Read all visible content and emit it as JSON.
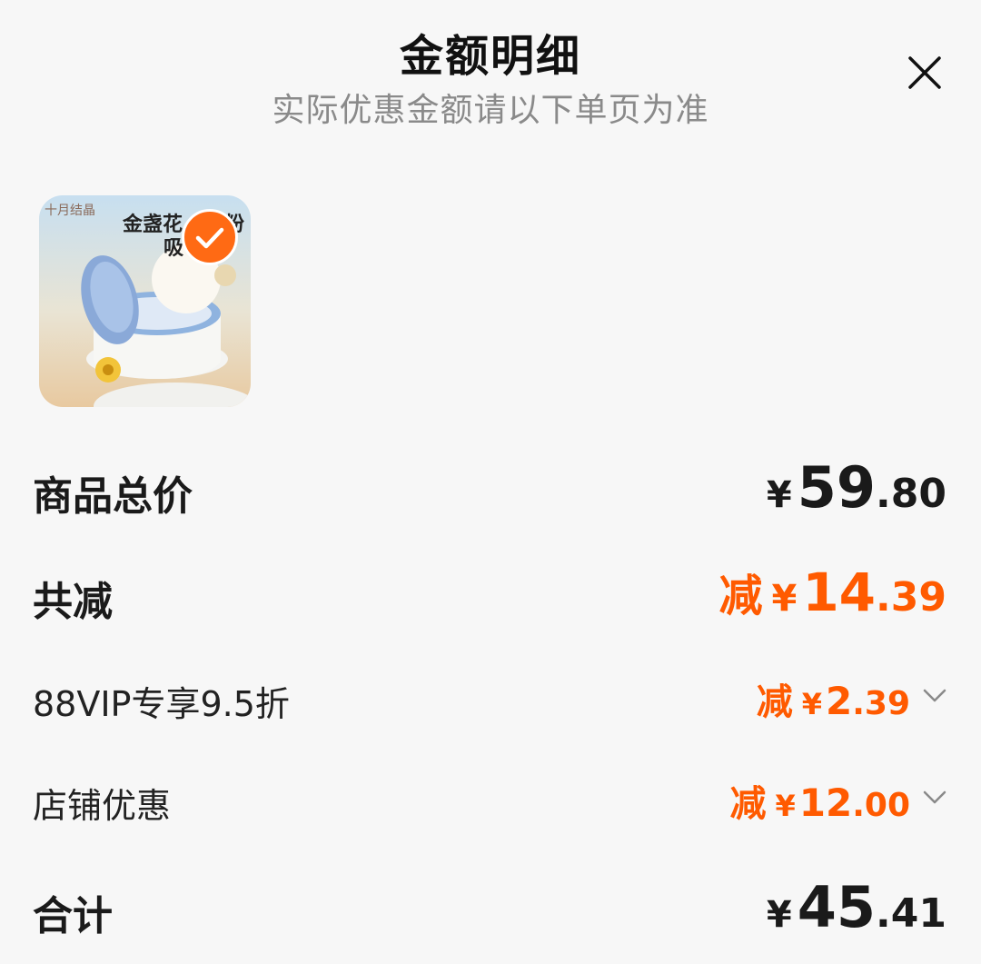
{
  "header": {
    "title": "金额明细",
    "subtitle": "实际优惠金额请以下单页为准"
  },
  "product": {
    "brand": "十月结晶",
    "line1": "金盏花",
    "line1b": "粉",
    "line2": "吸",
    "selected": true
  },
  "rows": {
    "total_price": {
      "label": "商品总价",
      "currency": "¥",
      "int": "59",
      "dec": ".80"
    },
    "total_discount": {
      "label": "共减",
      "prefix": "减",
      "currency": "¥",
      "int": "14",
      "dec": ".39"
    },
    "vip": {
      "label": "88VIP专享9.5折",
      "prefix": "减",
      "currency": "¥",
      "int": "2",
      "dec": ".39"
    },
    "shop": {
      "label": "店铺优惠",
      "prefix": "减",
      "currency": "¥",
      "int": "12",
      "dec": ".00"
    },
    "sum": {
      "label": "合计",
      "currency": "¥",
      "int": "45",
      "dec": ".41"
    }
  },
  "colors": {
    "accent": "#ff5a00",
    "check": "#ff6a14",
    "text": "#1a1a1a",
    "muted": "#8a8a8a"
  },
  "icons": [
    "close-icon",
    "check-icon",
    "chevron-down-icon"
  ]
}
